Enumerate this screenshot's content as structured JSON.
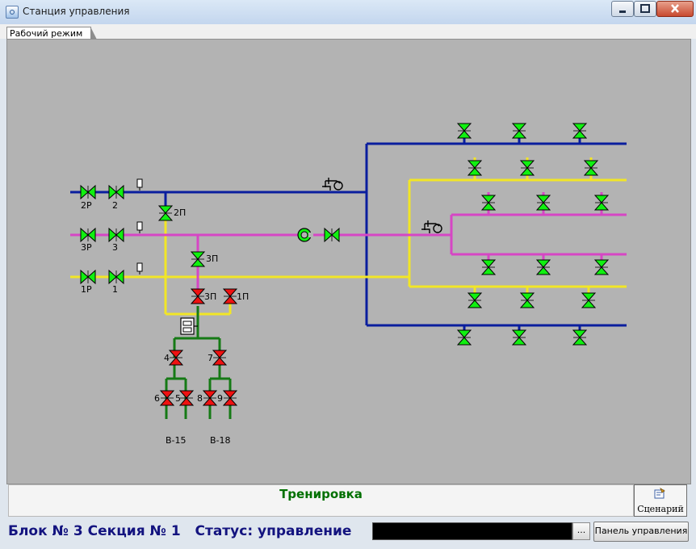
{
  "window": {
    "title": "Станция управления"
  },
  "tabs": [
    {
      "label": "Рабочий режим"
    }
  ],
  "diagram": {
    "valve_labels": {
      "v2p": "2Р",
      "v2": "2",
      "v3p": "3Р",
      "v3": "3",
      "v1p": "1Р",
      "v1": "1",
      "v2pn": "2П",
      "v3pn_y": "3П",
      "v3pn_r": "3П",
      "v1pn": "1П",
      "v4": "4",
      "v7": "7",
      "v6": "6",
      "v5": "5",
      "v8": "8",
      "v9": "9"
    },
    "outlets": {
      "left": "В-15",
      "right": "В-18"
    },
    "colors": {
      "blue": "#0a1e9e",
      "yellow": "#f2e626",
      "pink": "#d646c4",
      "green": "#157a15",
      "valve_open": "#10f010",
      "valve_closed": "#ee1111"
    }
  },
  "message_panel": {
    "mode": "Тренировка"
  },
  "scenario_button": {
    "label": "Сценарий"
  },
  "status": {
    "text": "Блок № 3 Секция № 1   Статус: управление"
  },
  "buttons": {
    "dots": "...",
    "control_panel": "Панель управления"
  }
}
